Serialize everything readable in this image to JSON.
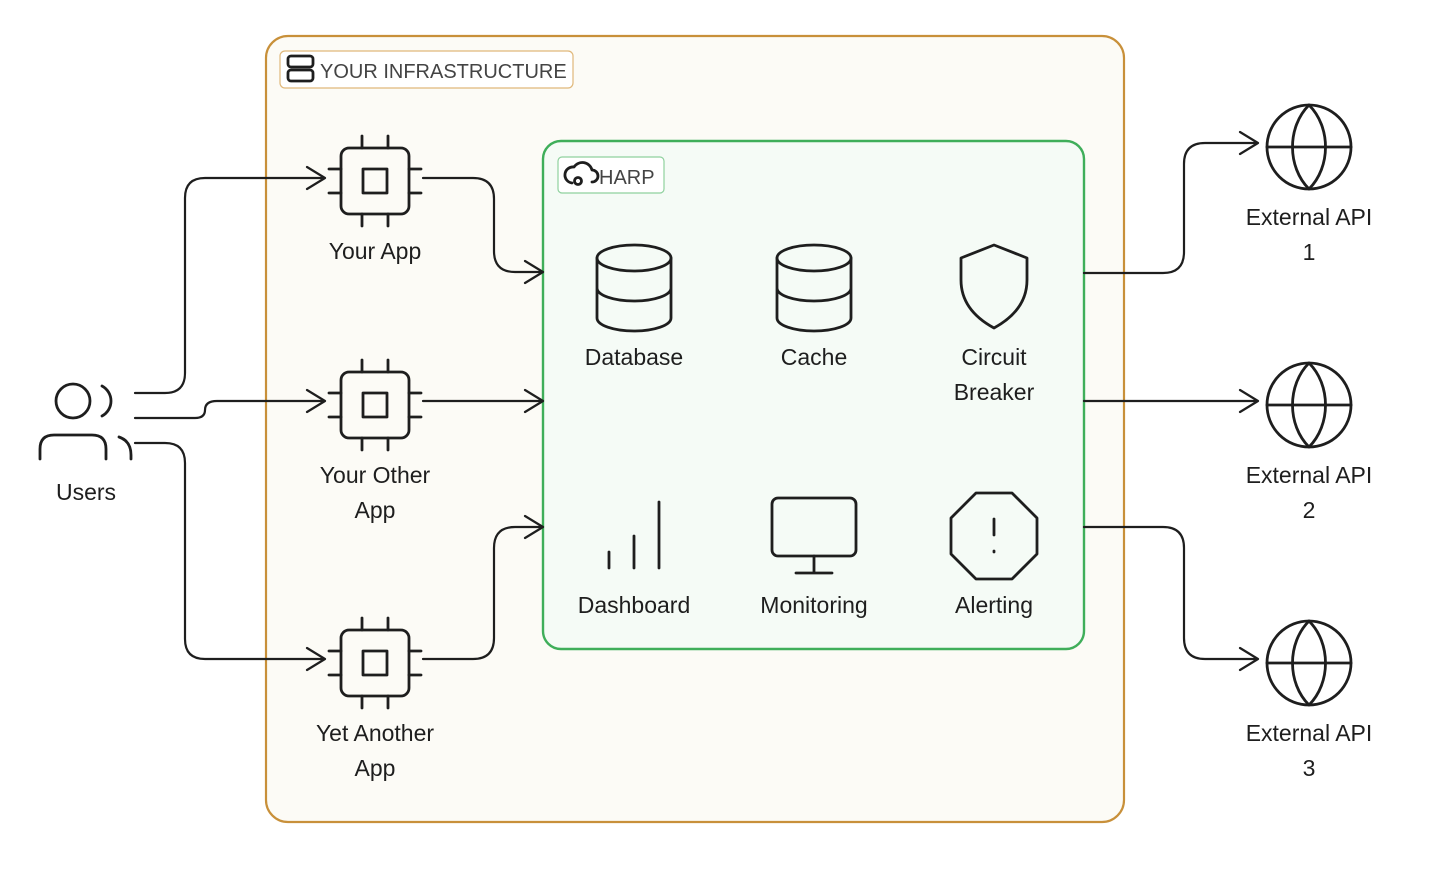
{
  "colors": {
    "infrastructure_border": "#c8903a",
    "infrastructure_fill": "#fcfbf6",
    "harp_border": "#3fae5a",
    "harp_fill": "#f5fbf6"
  },
  "users": {
    "label": "Users",
    "icon": "users-icon"
  },
  "infrastructure": {
    "label": "YOUR INFRASTRUCTURE",
    "icon": "server-icon",
    "apps": [
      {
        "line1": "Your App",
        "line2": "",
        "icon": "cpu-icon"
      },
      {
        "line1": "Your Other",
        "line2": "App",
        "icon": "cpu-icon"
      },
      {
        "line1": "Yet Another",
        "line2": "App",
        "icon": "cpu-icon"
      }
    ]
  },
  "harp": {
    "label": "HARP",
    "icon": "cloud-cog-icon",
    "components": [
      {
        "line1": "Database",
        "line2": "",
        "icon": "database-icon"
      },
      {
        "line1": "Cache",
        "line2": "",
        "icon": "database-icon"
      },
      {
        "line1": "Circuit",
        "line2": "Breaker",
        "icon": "shield-icon"
      },
      {
        "line1": "Dashboard",
        "line2": "",
        "icon": "bar-chart-icon"
      },
      {
        "line1": "Monitoring",
        "line2": "",
        "icon": "monitor-icon"
      },
      {
        "line1": "Alerting",
        "line2": "",
        "icon": "octagon-alert-icon"
      }
    ]
  },
  "external_apis": [
    {
      "line1": "External API",
      "line2": "1",
      "icon": "globe-icon"
    },
    {
      "line1": "External API",
      "line2": "2",
      "icon": "globe-icon"
    },
    {
      "line1": "External API",
      "line2": "3",
      "icon": "globe-icon"
    }
  ]
}
